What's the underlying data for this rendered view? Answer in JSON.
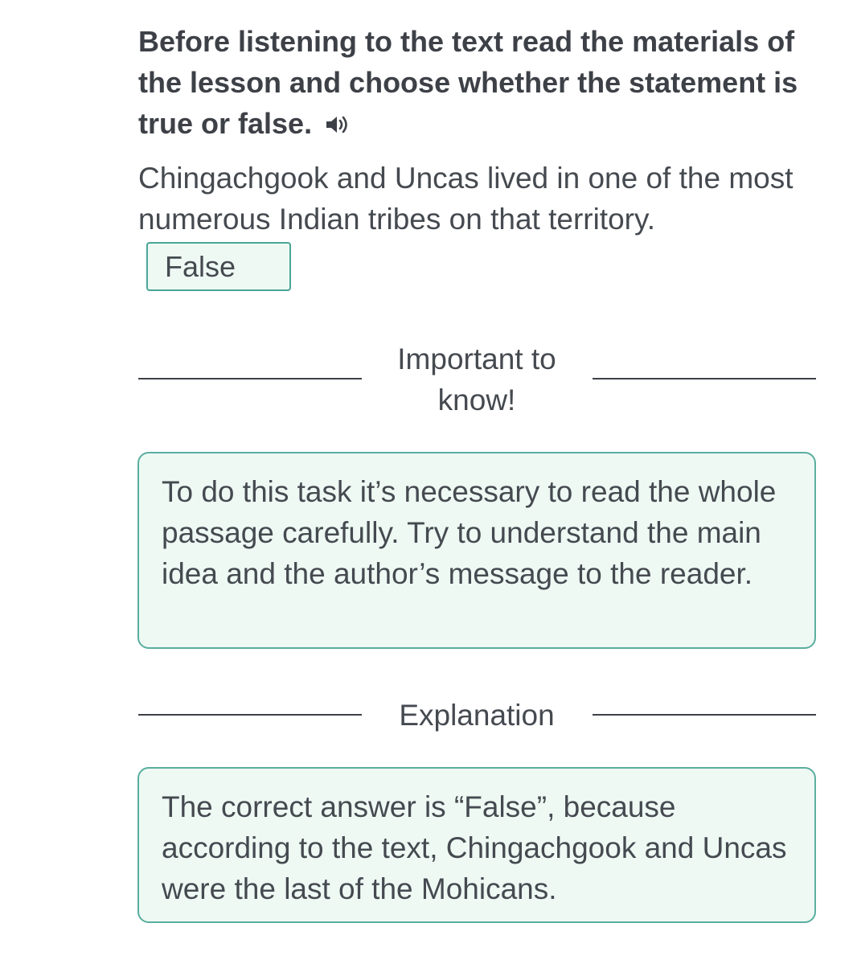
{
  "task": {
    "instruction": "Before listening to the text read the materials of the lesson and choose whether the statement is true or false.",
    "audio_icon": "speaker-icon",
    "statement": "Chingachgook and Uncas lived in one of the most numerous Indian tribes on that territory.",
    "selected_answer": "False"
  },
  "important": {
    "heading": "Important to know!",
    "text": "To do this task it’s necessary to read the whole passage carefully. Try to understand the main idea and the author’s message to the reader."
  },
  "explanation": {
    "heading": "Explanation",
    "text": "The correct answer is “False”, because according to the text, Chingachgook and Uncas were the last of the Mohicans."
  },
  "colors": {
    "accent_border": "#4aa596",
    "box_background": "#eef9f4",
    "text": "#454a50",
    "heading_text": "#3d4147"
  }
}
